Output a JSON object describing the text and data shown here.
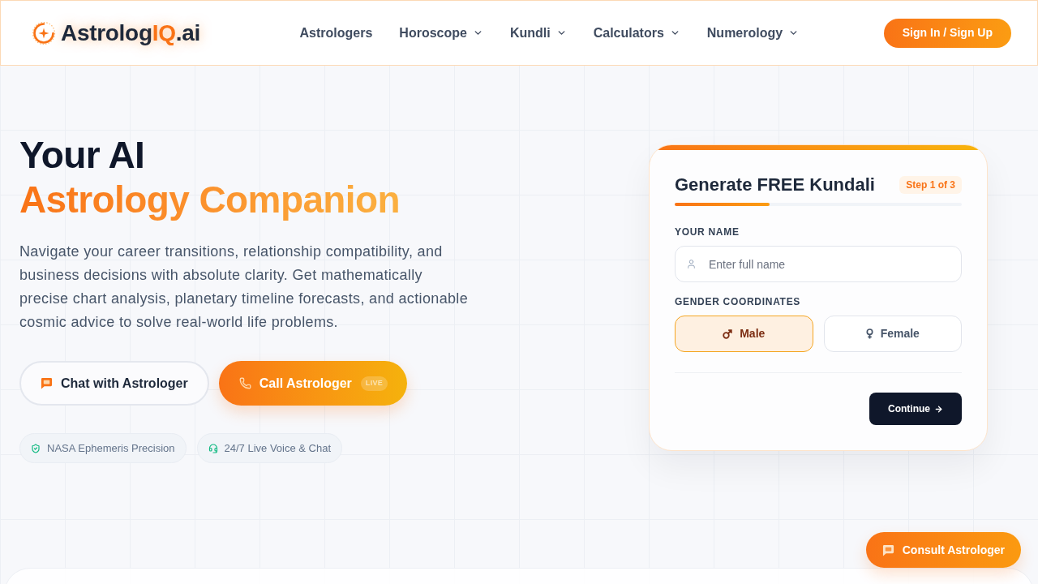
{
  "header": {
    "logo": {
      "parts": [
        {
          "text": "Astrolog",
          "accent": false
        },
        {
          "text": "IQ",
          "accent": true
        },
        {
          "text": ".ai",
          "accent": false
        }
      ]
    },
    "nav": [
      {
        "label": "Astrologers",
        "dropdown": false
      },
      {
        "label": "Horoscope",
        "dropdown": true
      },
      {
        "label": "Kundli",
        "dropdown": true
      },
      {
        "label": "Calculators",
        "dropdown": true
      },
      {
        "label": "Numerology",
        "dropdown": true
      }
    ],
    "auth_button": "Sign In / Sign Up"
  },
  "hero": {
    "title": [
      {
        "text": "Your AI",
        "accent": false
      },
      {
        "text": "Astrology Companion",
        "accent": true
      }
    ],
    "description": "Navigate your career transitions, relationship compatibility, and business decisions with absolute clarity. Get mathematically precise chart analysis, planetary timeline forecasts, and actionable cosmic advice to solve real-world life problems.",
    "actions": [
      {
        "kind": "outline",
        "label": "Chat with Astrologer"
      },
      {
        "kind": "primary",
        "label": "Call Astrologer",
        "badge": "LIVE"
      }
    ],
    "features": [
      {
        "label": "NASA Ephemeris Precision"
      },
      {
        "label": "24/7 Live Voice & Chat"
      }
    ]
  },
  "kundali_form": {
    "title": "Generate FREE Kundali",
    "step": "Step 1 of 3",
    "progress": {
      "level": 0.33
    },
    "name_field": {
      "label": "YOUR NAME",
      "placeholder": "Enter full name"
    },
    "gender": {
      "label": "GENDER COORDINATES",
      "options": [
        {
          "label": "Male",
          "selected": true
        },
        {
          "label": "Female",
          "selected": false
        }
      ]
    },
    "submit": "Continue"
  },
  "floating_button": {
    "label": "Consult Astrologer"
  }
}
